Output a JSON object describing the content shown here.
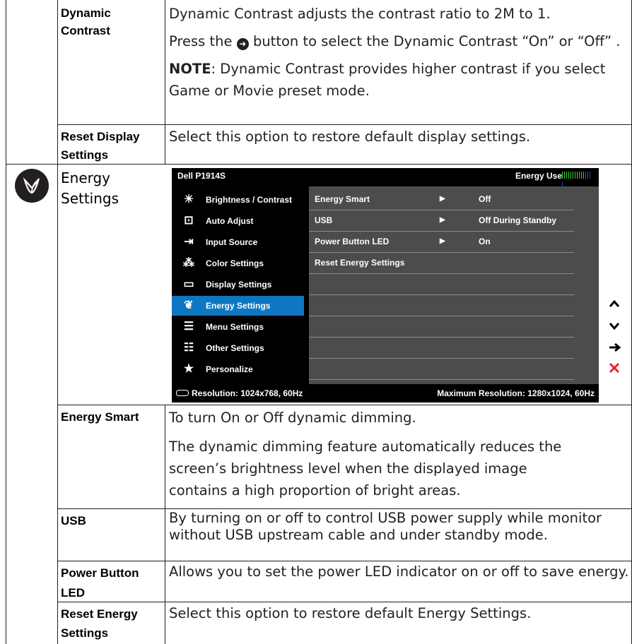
{
  "rows": {
    "dynamic_contrast": {
      "label": "Dynamic Contrast",
      "p1": "Dynamic Contrast adjusts the contrast ratio to 2M to 1.",
      "p2_pre": "Press the",
      "p2_post": "button to select the Dynamic Contrast “On” or “Off” .",
      "note_label": "NOTE",
      "note_text": ": Dynamic Contrast provides higher contrast if you select Game or Movie preset mode."
    },
    "reset_display": {
      "label": "Reset Display Settings",
      "desc": "Select this option to restore default display settings."
    },
    "energy_settings": {
      "label": "Energy Settings",
      "icon": "energy-leaf-icon"
    },
    "energy_smart": {
      "label": "Energy Smart",
      "p1": "To turn On or Off dynamic dimming.",
      "p2": "The dynamic dimming feature automatically reduces the screen’s brightness level when the displayed image contains a high proportion of bright areas."
    },
    "usb": {
      "label": "USB",
      "desc": "By turning on or off to control USB power supply while monitor without USB upstream cable and under standby mode."
    },
    "power_led": {
      "label": "Power Button LED",
      "desc": "Allows you to set the power LED indicator on or off to save energy."
    },
    "reset_energy": {
      "label": "Reset Energy Settings",
      "desc": "Select this option to restore default Energy Settings."
    }
  },
  "osd": {
    "title": "Dell P1914S",
    "energy_use_label": "Energy Use",
    "energy_use_level": 0.72,
    "menu": [
      {
        "label": "Brightness / Contrast",
        "icon": "brightness-icon"
      },
      {
        "label": "Auto Adjust",
        "icon": "auto-adjust-icon"
      },
      {
        "label": "Input Source",
        "icon": "input-source-icon"
      },
      {
        "label": "Color Settings",
        "icon": "color-settings-icon"
      },
      {
        "label": "Display Settings",
        "icon": "display-settings-icon"
      },
      {
        "label": "Energy Settings",
        "icon": "energy-leaf-icon",
        "selected": true
      },
      {
        "label": "Menu Settings",
        "icon": "menu-settings-icon"
      },
      {
        "label": "Other Settings",
        "icon": "other-settings-icon"
      },
      {
        "label": "Personalize",
        "icon": "star-icon"
      }
    ],
    "options": [
      {
        "name": "Energy Smart",
        "value": "Off"
      },
      {
        "name": "USB",
        "value": "Off During Standby"
      },
      {
        "name": "Power Button LED",
        "value": "On"
      },
      {
        "name": "Reset Energy Settings",
        "value": ""
      }
    ],
    "resolution": "Resolution: 1024x768,  60Hz",
    "max_resolution": "Maximum Resolution: 1280x1024,  60Hz"
  },
  "nav_keys": [
    {
      "icon": "up-arrow-icon",
      "glyph": "⌃"
    },
    {
      "icon": "down-arrow-icon",
      "glyph": "⌄"
    },
    {
      "icon": "right-arrow-icon",
      "glyph": "→"
    },
    {
      "icon": "exit-x-icon",
      "glyph": "✕"
    }
  ],
  "colors": {
    "osd_highlight": "#0f76c2",
    "osd_panel": "#4c4c4c",
    "exit_red": "#e8202a"
  }
}
